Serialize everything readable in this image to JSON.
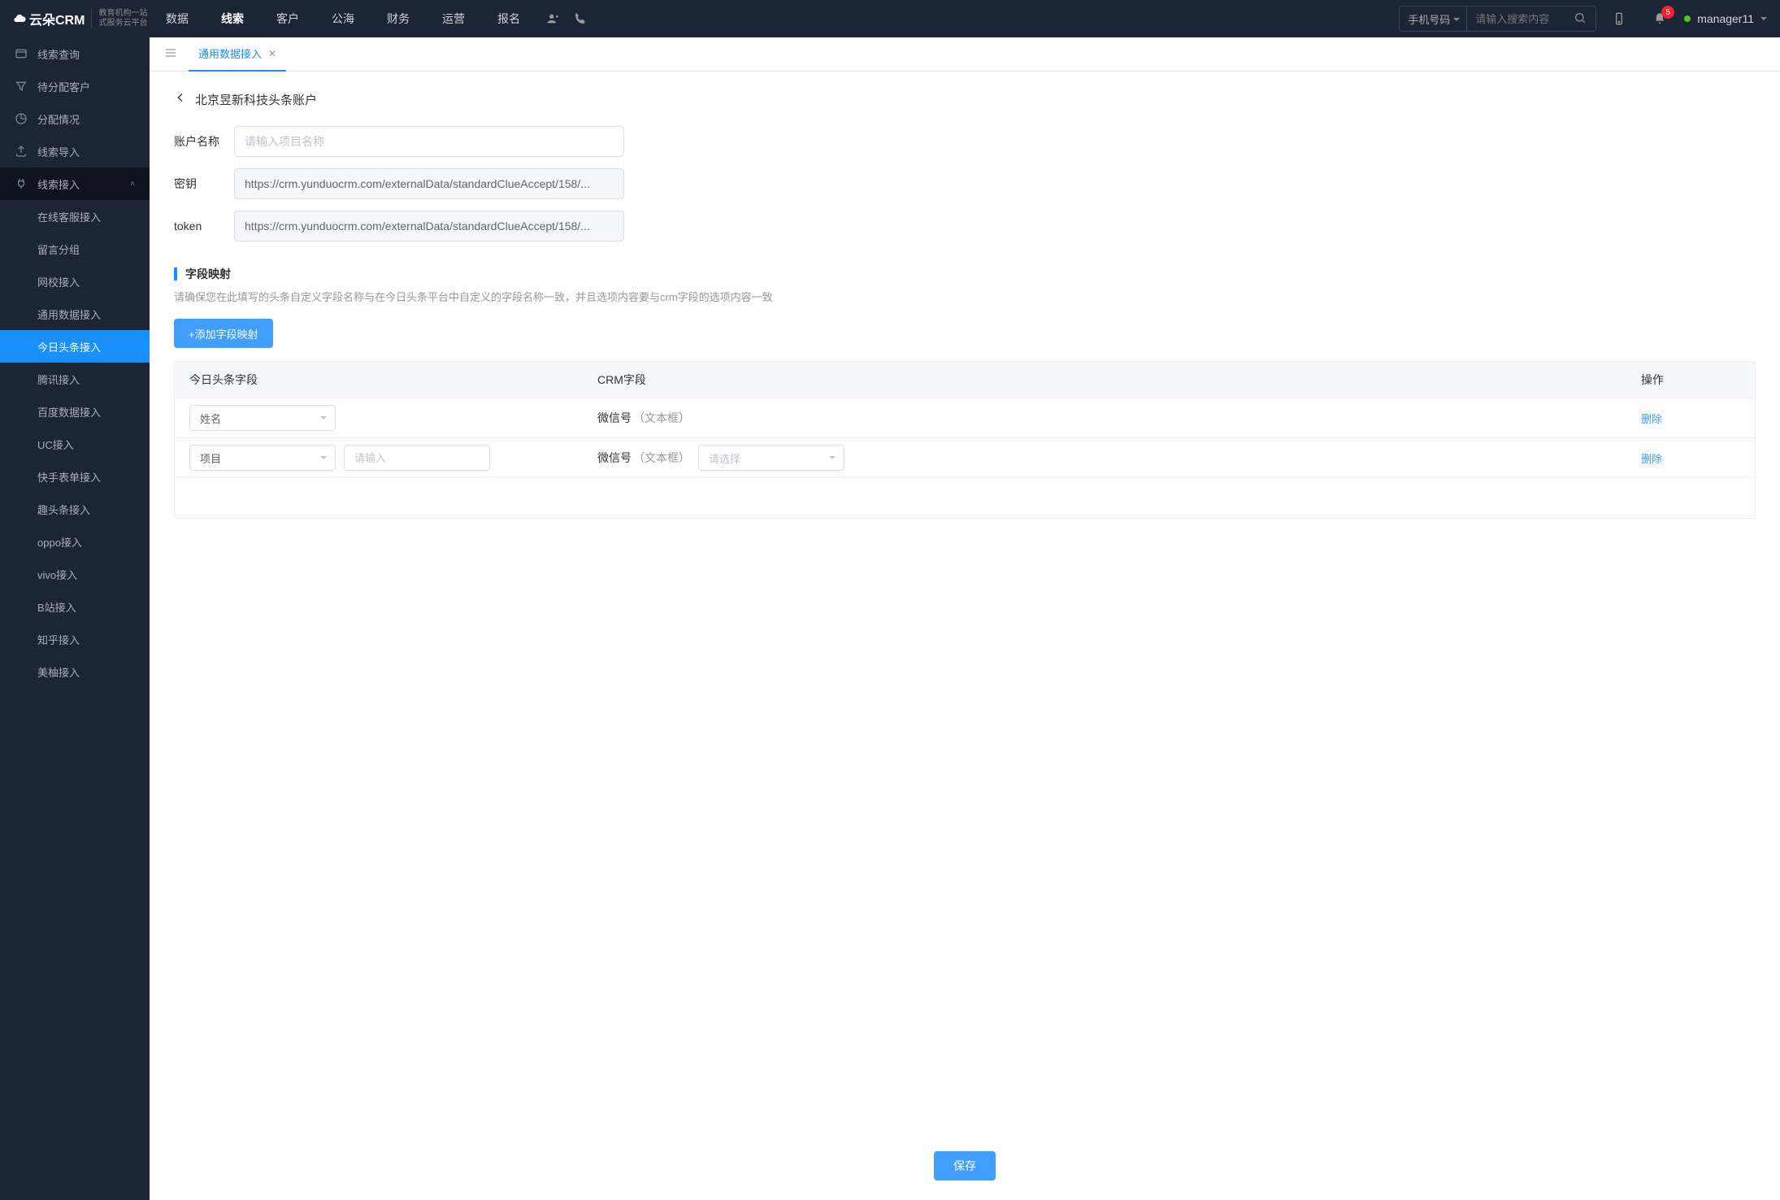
{
  "header": {
    "logo_main": "云朵CRM",
    "logo_sub_line1": "教育机构一站",
    "logo_sub_line2": "式服务云平台",
    "logo_url": "www.yunduocrm.com",
    "nav": [
      {
        "label": "数据"
      },
      {
        "label": "线索",
        "active": true
      },
      {
        "label": "客户"
      },
      {
        "label": "公海"
      },
      {
        "label": "财务"
      },
      {
        "label": "运营"
      },
      {
        "label": "报名"
      }
    ],
    "search_type": "手机号码",
    "search_placeholder": "请输入搜索内容",
    "notif_count": "5",
    "user_name": "manager11"
  },
  "sidebar": {
    "items": [
      {
        "label": "线索查询",
        "icon": "list"
      },
      {
        "label": "待分配客户",
        "icon": "filter"
      },
      {
        "label": "分配情况",
        "icon": "pie"
      },
      {
        "label": "线索导入",
        "icon": "upload"
      },
      {
        "label": "线索接入",
        "icon": "plug",
        "expanded": true
      }
    ],
    "sub_items": [
      {
        "label": "在线客服接入"
      },
      {
        "label": "留言分组"
      },
      {
        "label": "网校接入"
      },
      {
        "label": "通用数据接入"
      },
      {
        "label": "今日头条接入",
        "active": true
      },
      {
        "label": "腾讯接入"
      },
      {
        "label": "百度数据接入"
      },
      {
        "label": "UC接入"
      },
      {
        "label": "快手表单接入"
      },
      {
        "label": "趣头条接入"
      },
      {
        "label": "oppo接入"
      },
      {
        "label": "vivo接入"
      },
      {
        "label": "B站接入"
      },
      {
        "label": "知乎接入"
      },
      {
        "label": "美柚接入"
      }
    ]
  },
  "tabs": {
    "active_tab": "通用数据接入"
  },
  "page": {
    "title": "北京昱新科技头条账户",
    "account_name_label": "账户名称",
    "account_name_placeholder": "请输入项目名称",
    "secret_label": "密钥",
    "secret_value": "https://crm.yunduocrm.com/externalData/standardClueAccept/158/...",
    "token_label": "token",
    "token_value": "https://crm.yunduocrm.com/externalData/standardClueAccept/158/...",
    "mapping_section_title": "字段映射",
    "mapping_hint": "请确保您在此填写的头条自定义字段名称与在今日头条平台中自定义的字段名称一致，并且选项内容要与crm字段的选项内容一致",
    "add_button": "+添加字段映射",
    "table": {
      "head_toutiao": "今日头条字段",
      "head_crm": "CRM字段",
      "head_action": "操作",
      "rows": [
        {
          "field_select": "姓名",
          "extra_input": false,
          "crm_field": "微信号",
          "crm_type": "（文本框）",
          "crm_select": false,
          "action": "删除"
        },
        {
          "field_select": "项目",
          "extra_input": true,
          "extra_placeholder": "请输入",
          "crm_field": "微信号",
          "crm_type": "（文本框）",
          "crm_select": true,
          "crm_select_placeholder": "请选择",
          "action": "删除"
        }
      ]
    },
    "save_button": "保存"
  }
}
